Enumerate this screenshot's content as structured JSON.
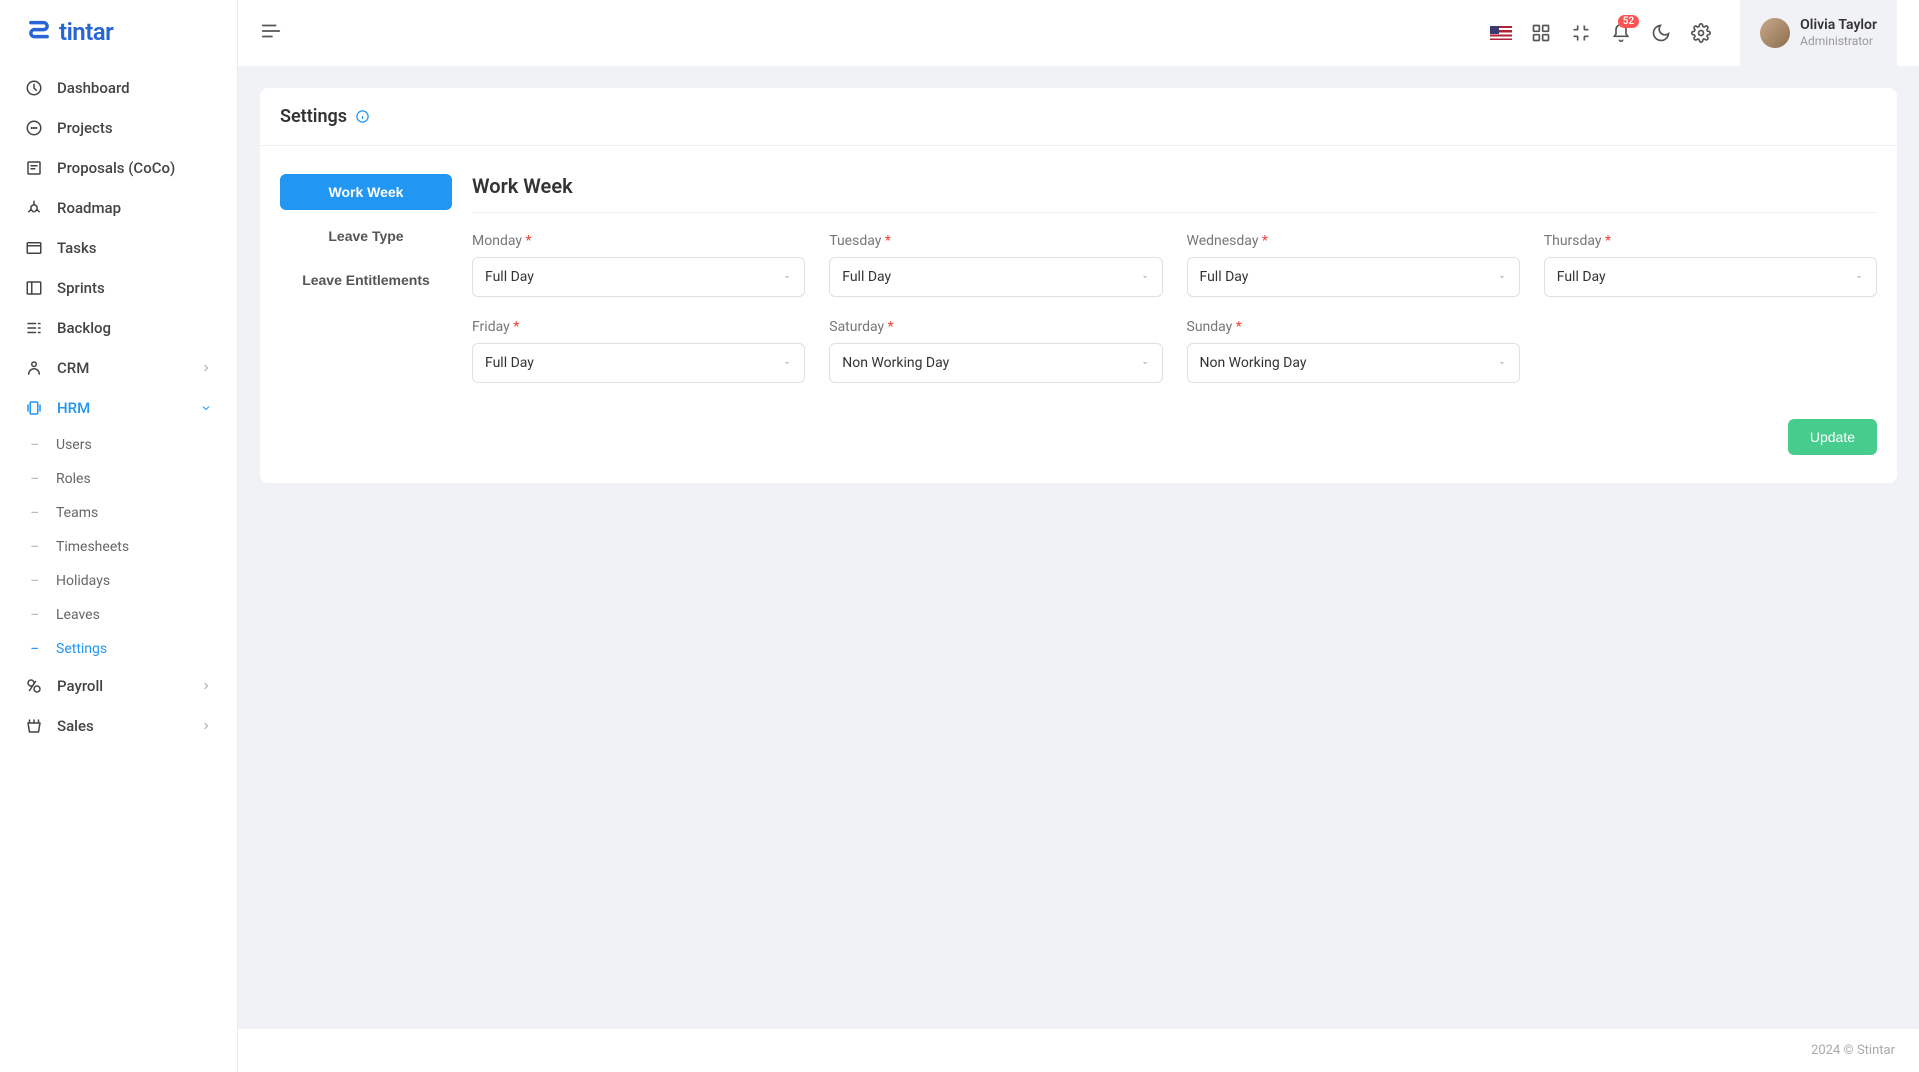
{
  "brand": {
    "name": "tintar"
  },
  "header": {
    "notifications_count": "52",
    "user_name": "Olivia Taylor",
    "user_role": "Administrator"
  },
  "sidebar": {
    "items": [
      {
        "label": "Dashboard",
        "icon": "dashboard"
      },
      {
        "label": "Projects",
        "icon": "projects"
      },
      {
        "label": "Proposals (CoCo)",
        "icon": "proposals"
      },
      {
        "label": "Roadmap",
        "icon": "roadmap"
      },
      {
        "label": "Tasks",
        "icon": "tasks"
      },
      {
        "label": "Sprints",
        "icon": "sprints"
      },
      {
        "label": "Backlog",
        "icon": "backlog"
      },
      {
        "label": "CRM",
        "icon": "crm",
        "hasSub": true
      },
      {
        "label": "HRM",
        "icon": "hrm",
        "hasSub": true,
        "active": true,
        "children": [
          {
            "label": "Users"
          },
          {
            "label": "Roles"
          },
          {
            "label": "Teams"
          },
          {
            "label": "Timesheets"
          },
          {
            "label": "Holidays"
          },
          {
            "label": "Leaves"
          },
          {
            "label": "Settings",
            "active": true
          }
        ]
      },
      {
        "label": "Payroll",
        "icon": "payroll",
        "hasSub": true
      },
      {
        "label": "Sales",
        "icon": "sales",
        "hasSub": true
      }
    ]
  },
  "page": {
    "title": "Settings",
    "tabs": [
      {
        "label": "Work Week",
        "active": true
      },
      {
        "label": "Leave Type"
      },
      {
        "label": "Leave Entitlements"
      }
    ],
    "form": {
      "title": "Work Week",
      "days": [
        {
          "label": "Monday",
          "value": "Full Day"
        },
        {
          "label": "Tuesday",
          "value": "Full Day"
        },
        {
          "label": "Wednesday",
          "value": "Full Day"
        },
        {
          "label": "Thursday",
          "value": "Full Day"
        },
        {
          "label": "Friday",
          "value": "Full Day"
        },
        {
          "label": "Saturday",
          "value": "Non Working Day"
        },
        {
          "label": "Sunday",
          "value": "Non Working Day"
        }
      ],
      "update_label": "Update"
    }
  },
  "footer": {
    "text": "2024 © Stintar"
  }
}
